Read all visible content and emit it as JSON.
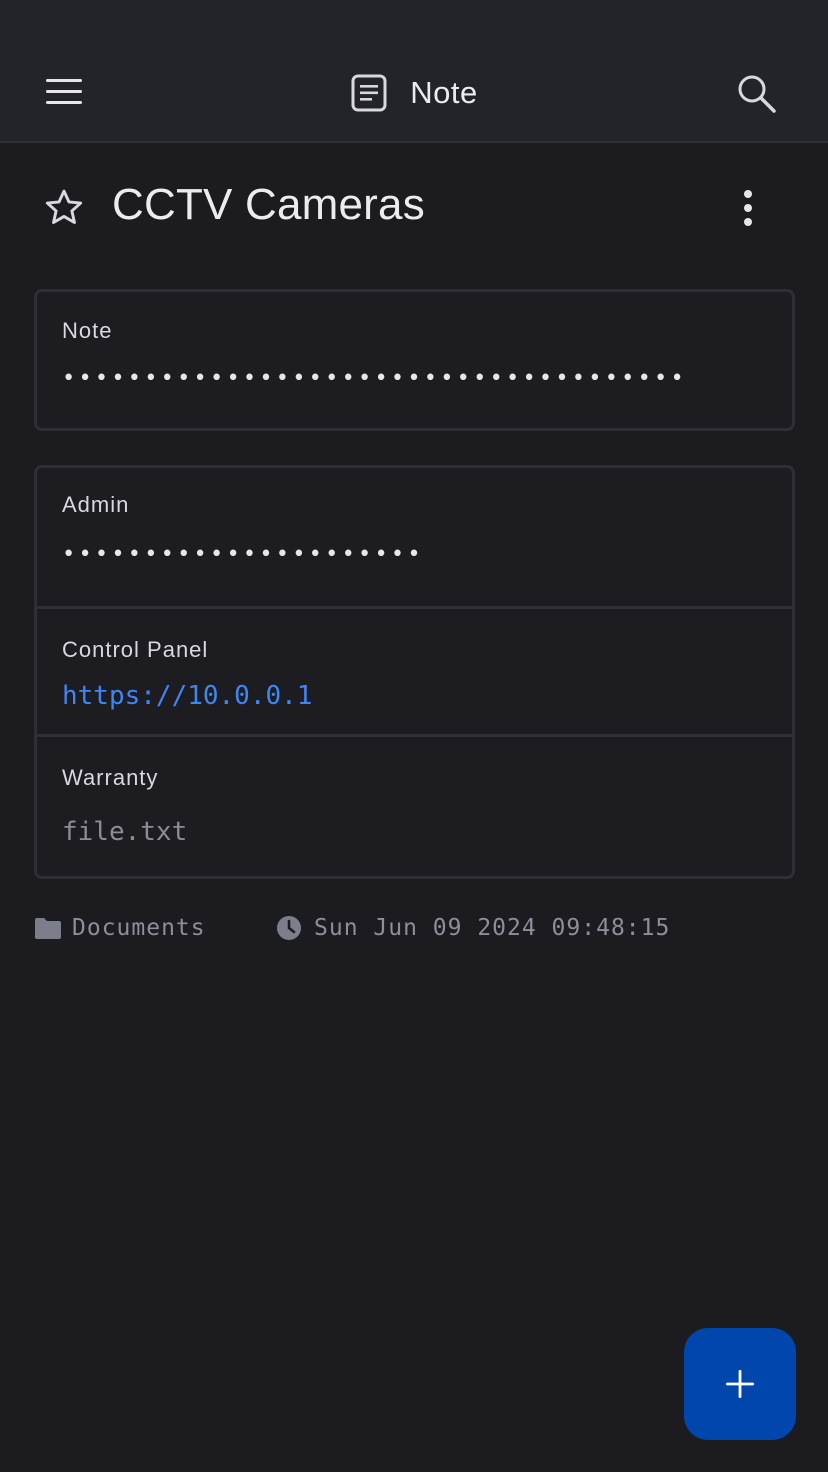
{
  "appbar": {
    "title": "Note",
    "title_icon": "note-icon",
    "menu_icon": "menu-icon",
    "search_icon": "search-icon"
  },
  "item": {
    "title": "CCTV Cameras",
    "favorite_icon": "star-outline-icon",
    "more_icon": "more-vertical-icon"
  },
  "fields": {
    "note": {
      "label": "Note",
      "value": "••••••••••••••••••••••••••••••••••••••"
    },
    "admin": {
      "label": "Admin",
      "value": "••••••••••••••••••••••"
    },
    "control_panel": {
      "label": "Control Panel",
      "value": "https://10.0.0.1"
    },
    "warranty": {
      "label": "Warranty",
      "value": "file.txt"
    }
  },
  "meta": {
    "folder": "Documents",
    "folder_icon": "folder-icon",
    "timestamp": "Sun Jun 09 2024 09:48:15",
    "clock_icon": "clock-icon"
  },
  "fab": {
    "icon": "plus-icon"
  },
  "colors": {
    "background": "#1b1b20",
    "appbar": "#232429",
    "link": "#3f86f4",
    "fab": "#0046ad",
    "border": "#2e2f35",
    "muted": "#8c8e99"
  }
}
